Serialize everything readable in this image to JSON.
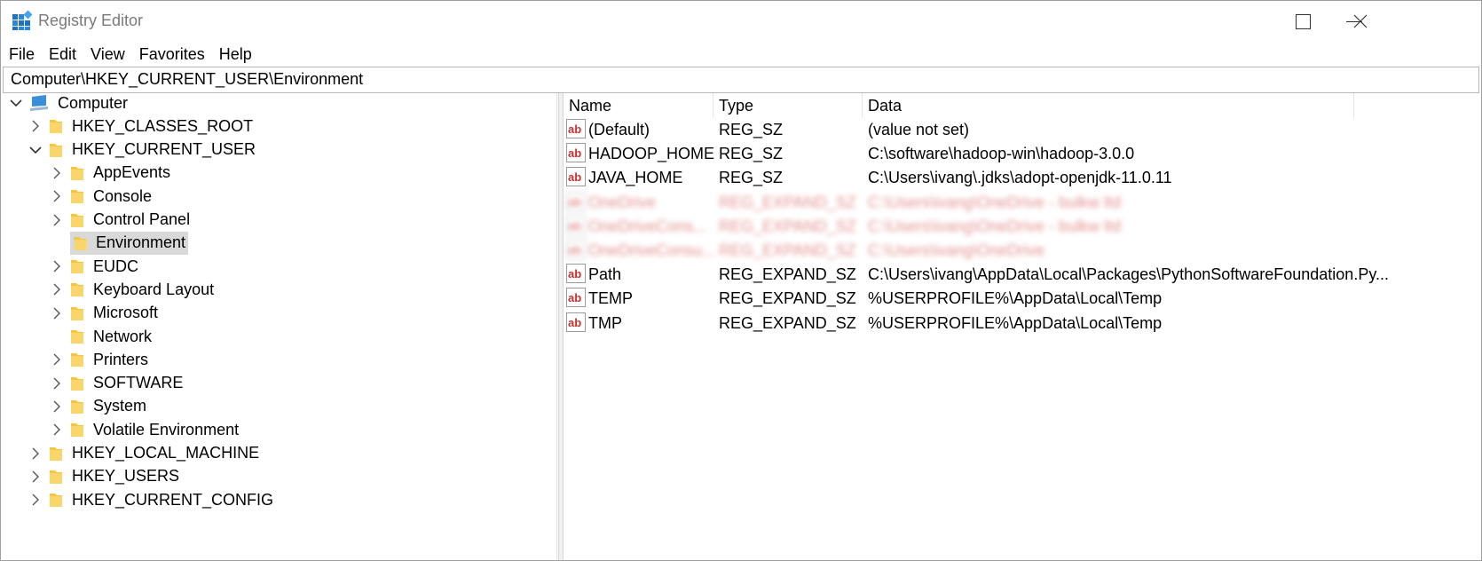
{
  "window": {
    "title": "Registry Editor"
  },
  "menu": [
    "File",
    "Edit",
    "View",
    "Favorites",
    "Help"
  ],
  "address": "Computer\\HKEY_CURRENT_USER\\Environment",
  "tree": {
    "root": "Computer",
    "hives": [
      {
        "label": "HKEY_CLASSES_ROOT",
        "expanded": false
      },
      {
        "label": "HKEY_CURRENT_USER",
        "expanded": true,
        "children": [
          {
            "label": "AppEvents",
            "has_children": true
          },
          {
            "label": "Console",
            "has_children": true
          },
          {
            "label": "Control Panel",
            "has_children": true
          },
          {
            "label": "Environment",
            "has_children": false,
            "selected": true
          },
          {
            "label": "EUDC",
            "has_children": true
          },
          {
            "label": "Keyboard Layout",
            "has_children": true
          },
          {
            "label": "Microsoft",
            "has_children": true
          },
          {
            "label": "Network",
            "has_children": false
          },
          {
            "label": "Printers",
            "has_children": true
          },
          {
            "label": "SOFTWARE",
            "has_children": true
          },
          {
            "label": "System",
            "has_children": true
          },
          {
            "label": "Volatile Environment",
            "has_children": true
          }
        ]
      },
      {
        "label": "HKEY_LOCAL_MACHINE",
        "expanded": false
      },
      {
        "label": "HKEY_USERS",
        "expanded": false
      },
      {
        "label": "HKEY_CURRENT_CONFIG",
        "expanded": false
      }
    ]
  },
  "columns": {
    "name": "Name",
    "type": "Type",
    "data": "Data"
  },
  "values": [
    {
      "name": "(Default)",
      "type": "REG_SZ",
      "data": "(value not set)",
      "blurred": false
    },
    {
      "name": "HADOOP_HOME",
      "type": "REG_SZ",
      "data": "C:\\software\\hadoop-win\\hadoop-3.0.0",
      "blurred": false
    },
    {
      "name": "JAVA_HOME",
      "type": "REG_SZ",
      "data": "C:\\Users\\ivang\\.jdks\\adopt-openjdk-11.0.11",
      "blurred": false
    },
    {
      "name": "OneDrive",
      "type": "REG_EXPAND_SZ",
      "data": "C:\\Users\\ivang\\OneDrive - bulkw ltd",
      "blurred": true
    },
    {
      "name": "OneDriveCons...",
      "type": "REG_EXPAND_SZ",
      "data": "C:\\Users\\ivang\\OneDrive - bulkw ltd",
      "blurred": true
    },
    {
      "name": "OneDriveConsu...",
      "type": "REG_EXPAND_SZ",
      "data": "C:\\Users\\ivang\\OneDrive",
      "blurred": true
    },
    {
      "name": "Path",
      "type": "REG_EXPAND_SZ",
      "data": "C:\\Users\\ivang\\AppData\\Local\\Packages\\PythonSoftwareFoundation.Py...",
      "blurred": false
    },
    {
      "name": "TEMP",
      "type": "REG_EXPAND_SZ",
      "data": "%USERPROFILE%\\AppData\\Local\\Temp",
      "blurred": false
    },
    {
      "name": "TMP",
      "type": "REG_EXPAND_SZ",
      "data": "%USERPROFILE%\\AppData\\Local\\Temp",
      "blurred": false
    }
  ],
  "colors": {
    "folder": "#f5c542",
    "selection": "#d9d9d9",
    "icon_red": "#c8312e"
  }
}
